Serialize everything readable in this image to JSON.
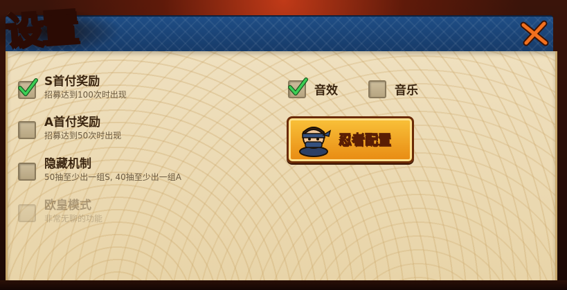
{
  "title": "设置",
  "options_left": [
    {
      "label": "S首付奖励",
      "sub": "招募达到100次时出现",
      "checked": true
    },
    {
      "label": "A首付奖励",
      "sub": "招募达到50次时出现",
      "checked": false
    },
    {
      "label": "隐藏机制",
      "sub": "50抽至少出一组S, 40抽至少出一组A",
      "checked": false
    },
    {
      "label": "欧皇模式",
      "sub": "非常无聊的功能",
      "checked": false,
      "disabled": true
    }
  ],
  "sound": {
    "label": "音效",
    "checked": true
  },
  "music": {
    "label": "音乐",
    "checked": false
  },
  "ninja_button": {
    "label": "忍者配置"
  },
  "colors": {
    "accent": "#e8432a",
    "header_blue": "#1f4e86",
    "panel": "#efe0bf",
    "button_orange": "#f5a623",
    "check_green": "#2fb34a"
  }
}
